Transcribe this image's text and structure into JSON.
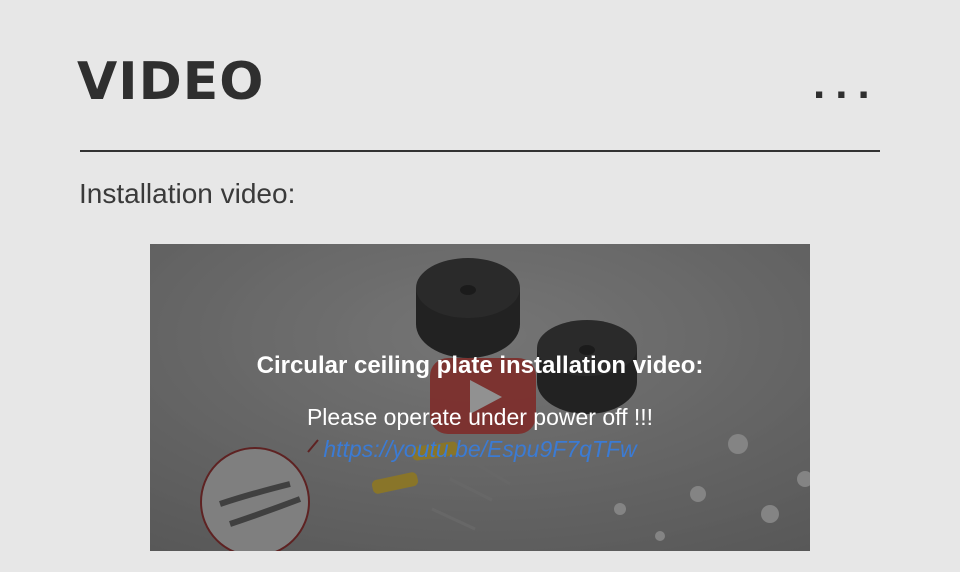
{
  "header": {
    "title": "VIDEO",
    "more": "..."
  },
  "section": {
    "label": "Installation video:"
  },
  "video": {
    "title": "Circular ceiling plate installation video:",
    "note": "Please operate under power off !!!",
    "link": "https://youtu.be/Espu9F7qTFw",
    "link_color": "#3b7bd4",
    "play_button_color": "#c4302b",
    "play_icon": "youtube-play-icon"
  }
}
